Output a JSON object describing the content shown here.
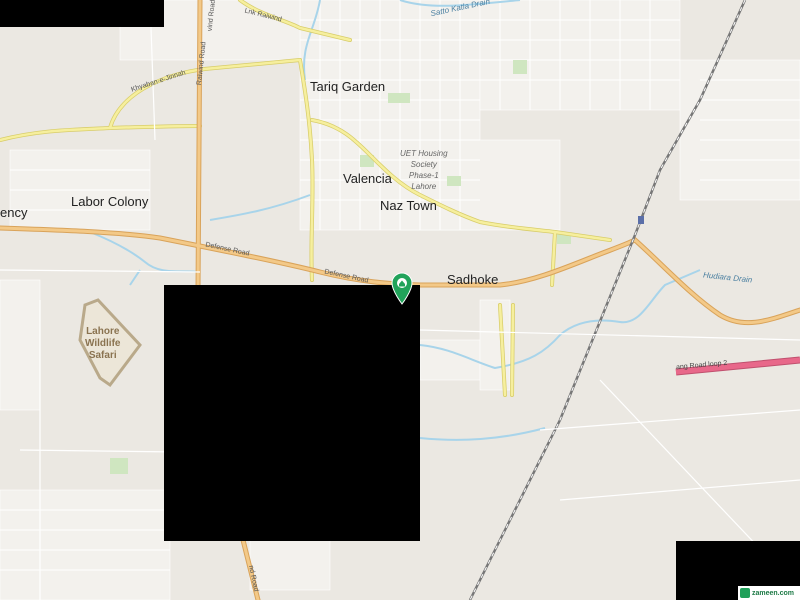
{
  "map": {
    "place_labels": {
      "tariq_garden": "Tariq Garden",
      "valencia": "Valencia",
      "naz_town": "Naz Town",
      "labor_colony": "Labor Colony",
      "sadhoke": "Sadhoke",
      "agency_partial": "ency",
      "lahore_wildlife_safari": "Lahore\nWildlife\nSafari",
      "uet_housing": "UET Housing\nSociety\nPhase-1\nLahore"
    },
    "road_labels": {
      "defense_road_1": "Defense Road",
      "defense_road_2": "Defense Road",
      "khayaban_e_jinnah": "Khyaban-e-Jinnah",
      "link_raiwind": "Lnk Raiwind",
      "raiwind_road": "Raiwind Road",
      "ring_road_loop": "ang Road loop 2",
      "old_road_partial": "vind Road",
      "lower_road_partial": "nd Road"
    },
    "water_labels": {
      "hudiara_drain": "Hudiara Drain",
      "satto_katla_drain": "Satto Katla Drain"
    },
    "marker": {
      "name": "location-pin",
      "color": "#21a35a"
    },
    "colors": {
      "background": "#ebe8e2",
      "major_road": "#f3c988",
      "secondary_road": "#f6ef9e",
      "water": "#a8d4ea",
      "ring_road": "#e8688a",
      "railway": "#777777",
      "park": "#cfe6c0",
      "built": "#ffffff"
    },
    "attribution": "zameen.com"
  }
}
